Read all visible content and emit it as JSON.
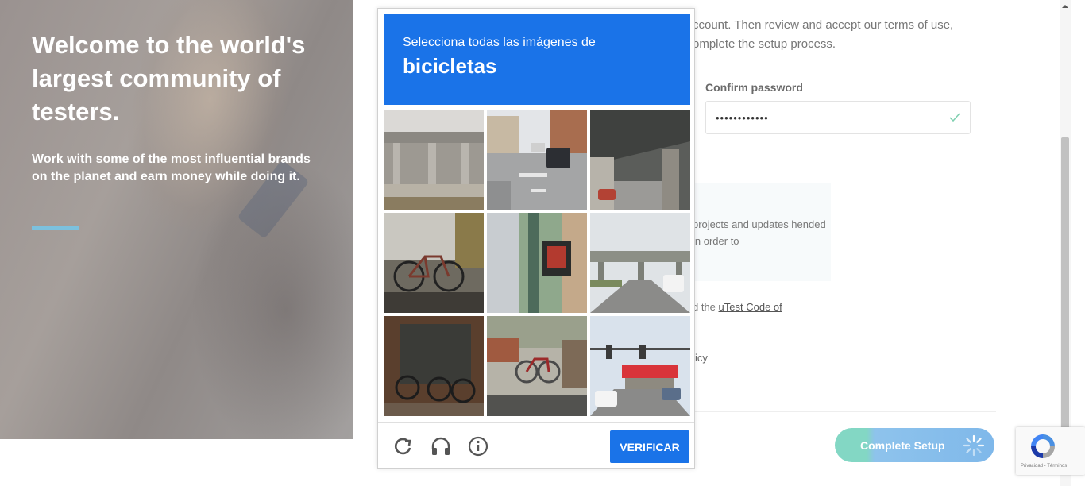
{
  "hero": {
    "title": "Welcome to the world's largest community of testers.",
    "subtitle": "Work with some of the most influential brands on the planet and earn money while doing it."
  },
  "form": {
    "intro_text": "ccount. Then review and accept our terms of use, omplete the setup process.",
    "confirm_password_label": "Confirm password",
    "confirm_password_value": "••••••••••••",
    "info_text": "projects and updates hended in order to",
    "code_prefix": "d the ",
    "code_link": "uTest Code of",
    "privacy_fragment": "icy",
    "complete_button": "Complete Setup"
  },
  "captcha": {
    "instruction": "Selecciona todas las imágenes de",
    "keyword": "bicicletas",
    "tiles": [
      {
        "icon": "overpass-image"
      },
      {
        "icon": "street-cars-image"
      },
      {
        "icon": "bridge-underside-image"
      },
      {
        "icon": "bicycle-on-car-image"
      },
      {
        "icon": "crosswalk-signal-image"
      },
      {
        "icon": "highway-bridge-image"
      },
      {
        "icon": "bicycles-storefront-image"
      },
      {
        "icon": "bicycles-parked-image"
      },
      {
        "icon": "traffic-light-intersection-image"
      }
    ],
    "reload_icon": "reload-icon",
    "audio_icon": "headphones-icon",
    "info_icon": "info-icon",
    "verify_label": "VERIFICAR",
    "accent": "#1a73e8"
  },
  "recaptcha_badge": {
    "terms_text": "Privacidad - Términos"
  }
}
